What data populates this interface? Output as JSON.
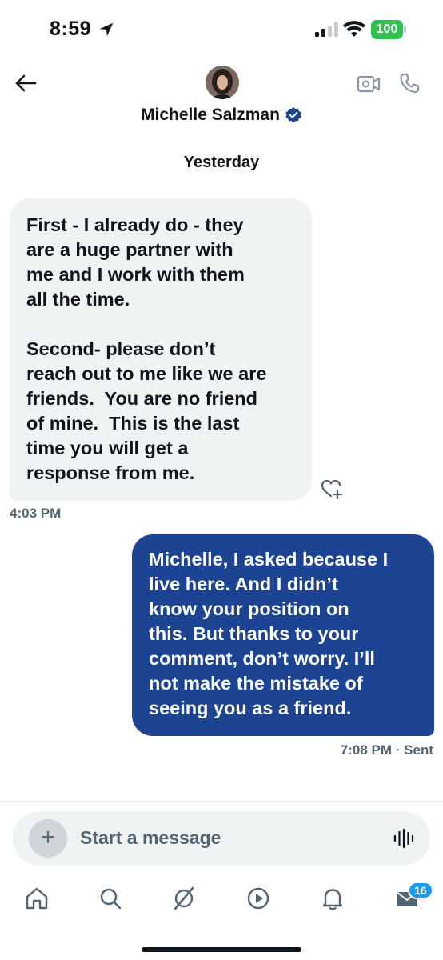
{
  "status_bar": {
    "time": "8:59",
    "battery": "100",
    "icons": [
      "location-arrow-icon",
      "cellular-signal-icon",
      "wifi-icon",
      "battery-icon"
    ]
  },
  "header": {
    "contact_name": "Michelle Salzman",
    "verified": true,
    "icons": [
      "back-arrow-icon",
      "video-camera-icon",
      "phone-icon",
      "verified-badge-icon"
    ]
  },
  "conversation": {
    "date_label": "Yesterday",
    "messages": [
      {
        "direction": "incoming",
        "text": "First - I already do - they\nare a huge partner with\nme and I work with them\nall the time.\n\nSecond- please don’t\nreach out to me like we are\nfriends.  You are no friend\nof mine.  This is the last\ntime you will get a\nresponse from me.",
        "time": "4:03 PM"
      },
      {
        "direction": "outgoing",
        "text": "Michelle, I asked because I\nlive here. And I didn’t\nknow your position on\nthis. But thanks to your\ncomment, don’t worry. I’ll\nnot make the mistake of\nseeing you as a friend.",
        "time": "7:08 PM · Sent"
      }
    ]
  },
  "composer": {
    "placeholder": "Start a message",
    "icons": [
      "plus-icon",
      "voice-waveform-icon"
    ]
  },
  "tab_bar": {
    "tabs": [
      "home",
      "search",
      "grok",
      "video",
      "notifications",
      "messages"
    ],
    "messages_badge": "16"
  },
  "colors": {
    "incoming_bubble": "#eff3f4",
    "outgoing_bubble": "#1d4493",
    "verified": "#1d4493",
    "badge": "#1d9bf0",
    "battery": "#30c04f",
    "secondary_text": "#536471"
  }
}
